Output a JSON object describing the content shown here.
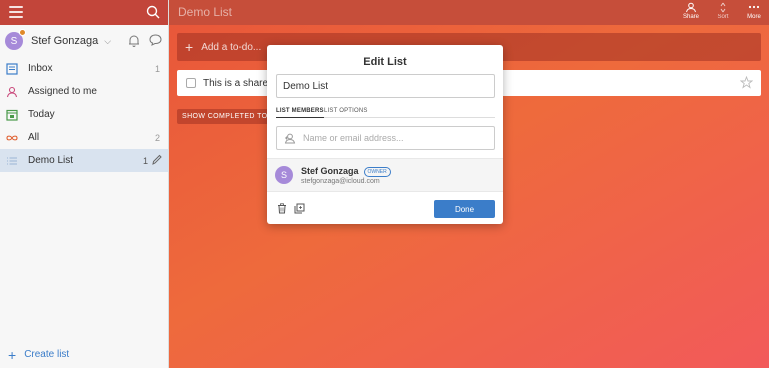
{
  "sidebar": {
    "user": {
      "initial": "S",
      "name": "Stef Gonzaga",
      "chevron": "⌵"
    },
    "items": [
      {
        "label": "Inbox",
        "count": "1",
        "icon": "inbox-icon"
      },
      {
        "label": "Assigned to me",
        "count": "",
        "icon": "assigned-user-icon"
      },
      {
        "label": "Today",
        "count": "",
        "icon": "calendar-icon"
      },
      {
        "label": "All",
        "count": "2",
        "icon": "infinity-icon"
      },
      {
        "label": "Demo List",
        "count": "1",
        "icon": "list-icon"
      }
    ],
    "create_list": "Create list"
  },
  "topbar": {
    "title": "Demo List",
    "share": "Share",
    "sort": "Sort",
    "more": "More"
  },
  "main": {
    "add_placeholder": "Add a to-do...",
    "todo_text": "This is a shared ta",
    "show_completed": "SHOW COMPLETED TO-"
  },
  "modal": {
    "title": "Edit List",
    "list_name": "Demo List",
    "tab_members": "LIST MEMBERS",
    "tab_options": "LIST OPTIONS",
    "member_placeholder": "Name or email address...",
    "member": {
      "initial": "S",
      "name": "Stef Gonzaga",
      "badge": "OWNER",
      "email": "stefgonzaga@icloud.com"
    },
    "done": "Done"
  },
  "colors": {
    "accent": "#3b7dc9",
    "avatar": "#a68ad9",
    "background_start": "#e8563a",
    "background_end": "#f25a5a"
  }
}
